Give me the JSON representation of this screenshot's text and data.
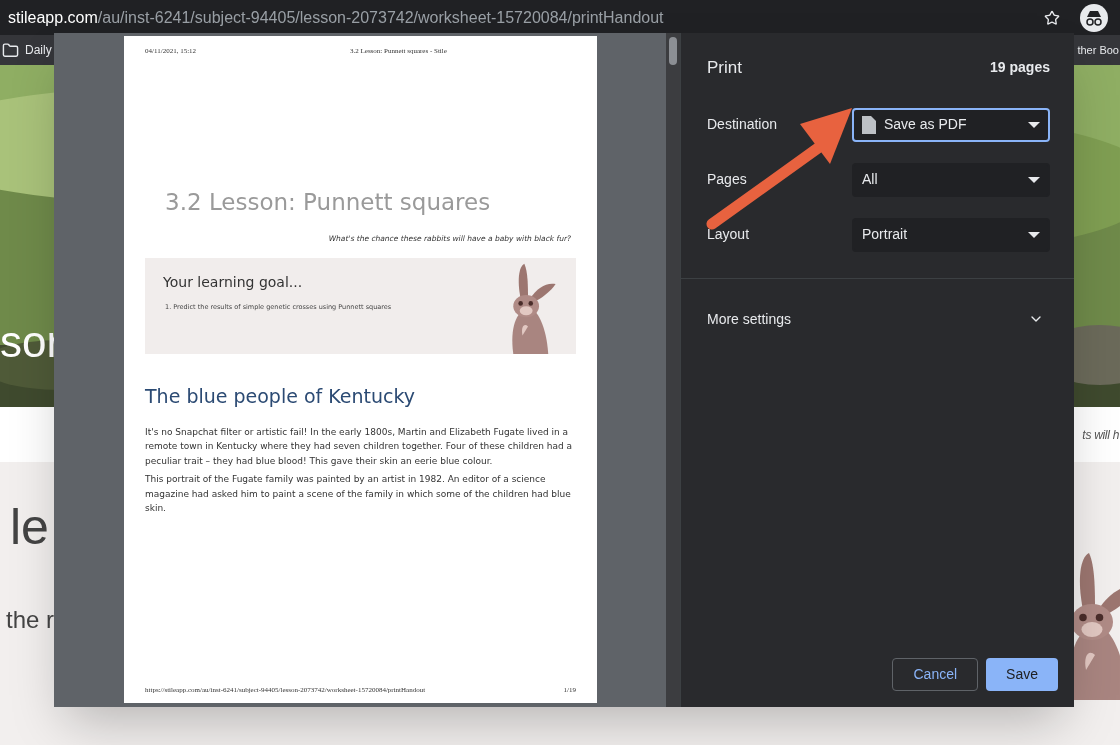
{
  "browser": {
    "url_host": "stileapp.com",
    "url_path": "/au/inst-6241/subject-94405/lesson-2073742/worksheet-15720084/printHandout",
    "bookmarks": [
      {
        "label": "Daily"
      },
      {
        "label": "ther Boo"
      }
    ]
  },
  "background_page": {
    "hero_text": "sor",
    "subtitle": "ts will h",
    "heading": "le",
    "text": "the r"
  },
  "print_preview": {
    "header_date": "04/11/2021, 15:12",
    "header_title": "3.2 Lesson: Punnett squares - Stile",
    "title": "3.2 Lesson: Punnett squares",
    "subtitle": "What's the chance these rabbits will have a baby with black fur?",
    "goal_title": "Your learning goal...",
    "goal_items": [
      "1. Predict the results of simple genetic crosses using Punnett squares"
    ],
    "section_heading": "The blue people of Kentucky",
    "paragraphs": [
      "It's no Snapchat filter or artistic fail! In the early 1800s, Martin and Elizabeth Fugate lived in a remote town in Kentucky where they had seven children together. Four of these children had a peculiar trait – they had blue blood! This gave their skin an eerie blue colour.",
      "This portrait of the Fugate family was painted by an artist in 1982. An editor of a science magazine had asked him to paint a scene of the family in which some of the children had blue skin."
    ],
    "footer_url": "https://stileapp.com/au/inst-6241/subject-94405/lesson-2073742/worksheet-15720084/printHandout",
    "footer_page": "1/19"
  },
  "print_dialog": {
    "title": "Print",
    "page_count": "19 pages",
    "settings": [
      {
        "label": "Destination",
        "value": "Save as PDF",
        "focused": true,
        "kind": "file"
      },
      {
        "label": "Pages",
        "value": "All",
        "focused": false,
        "kind": "plain"
      },
      {
        "label": "Layout",
        "value": "Portrait",
        "focused": false,
        "kind": "plain"
      }
    ],
    "more_settings": {
      "label": "More settings",
      "expanded": false
    },
    "buttons": [
      {
        "label": "Cancel",
        "kind": "secondary"
      },
      {
        "label": "Save",
        "kind": "primary"
      }
    ]
  }
}
